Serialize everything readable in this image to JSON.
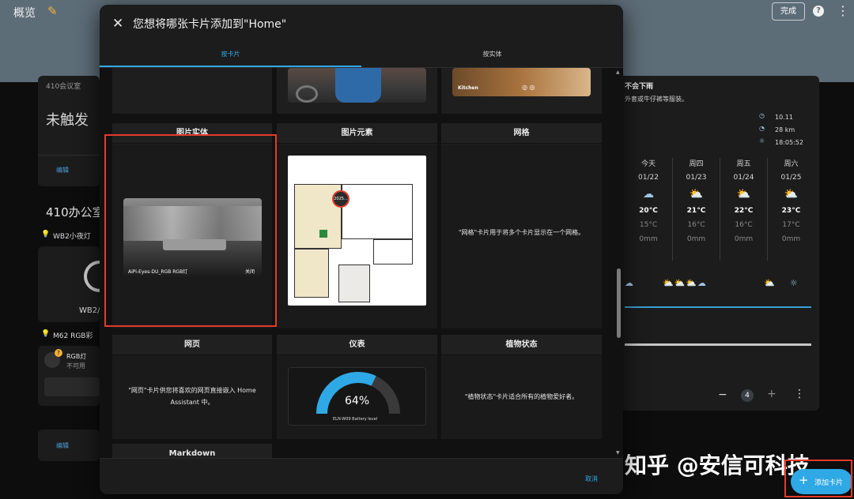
{
  "topbar": {
    "title": "概览",
    "edit_icon": "pencil-icon",
    "done_label": "完成",
    "help_icon": "help-icon",
    "more_icon": "more-vert-icon"
  },
  "background": {
    "room_label": "410会议室",
    "room_state": "未触发",
    "edit_label_1": "编辑",
    "section_title": "410办公室",
    "light_1": "WB2小夜灯",
    "light_1_short": "WB2/",
    "light_2": "M62 RGB彩",
    "rgb_name": "RGB灯",
    "rgb_state": "不可用",
    "badge": "?",
    "edit_label_2": "编辑",
    "weather_line1": "不会下雨",
    "weather_line2": "外套或牛仔裤等服装。",
    "sun_rows": [
      {
        "icon": "clock-icon",
        "value": "10.11"
      },
      {
        "icon": "gauge-icon",
        "value": "28 km"
      },
      {
        "icon": "sunset-icon",
        "value": "18:05:52"
      }
    ],
    "forecast": [
      {
        "day": "今天",
        "date": "01/22",
        "hi": "20°C",
        "lo": "15°C",
        "rain": "0mm"
      },
      {
        "day": "周四",
        "date": "01/23",
        "hi": "21°C",
        "lo": "16°C",
        "rain": "0mm"
      },
      {
        "day": "周五",
        "date": "01/24",
        "hi": "22°C",
        "lo": "16°C",
        "rain": "0mm"
      },
      {
        "day": "周六",
        "date": "01/25",
        "hi": "23°C",
        "lo": "17°C",
        "rain": "0mm"
      }
    ],
    "pager_value": "4",
    "minus": "−",
    "plus": "+",
    "more": "⋮"
  },
  "dialog": {
    "title": "您想将哪张卡片添加到\"Home\"",
    "close_icon": "close-icon",
    "tabs": [
      {
        "label": "按卡片",
        "active": true
      },
      {
        "label": "按实体",
        "active": false
      }
    ],
    "cards": {
      "picture_entity": {
        "title": "图片实体",
        "entity": "AiPi-Eyes-DU_RGB RGB灯",
        "state": "关闭"
      },
      "picture_elements": {
        "title": "图片元素",
        "marker": "2025..."
      },
      "grid": {
        "title": "网格",
        "description": "\"网格\"卡片用于将多个卡片显示在一个网格。"
      },
      "webpage": {
        "title": "网页",
        "description": "\"网页\"卡片供您将喜欢的网页直接嵌入 Home Assistant 中。"
      },
      "gauge": {
        "title": "仪表",
        "value": "64%",
        "level": 0.64,
        "entity": "ELN-W09 Battery level"
      },
      "plant": {
        "title": "植物状态",
        "description": "\"植物状态\"卡片适合所有的植物爱好者。"
      },
      "markdown": {
        "title": "Markdown"
      },
      "top_right": {
        "label": "Kitchen"
      }
    },
    "cancel_label": "取消"
  },
  "fab": {
    "label": "添加卡片",
    "icon": "plus-icon"
  },
  "watermark": "知乎 @安信可科技",
  "colors": {
    "accent": "#2fa8e6",
    "highlight": "#e43b2c",
    "topbar": "#5d6d78",
    "edit": "#f2b138"
  }
}
